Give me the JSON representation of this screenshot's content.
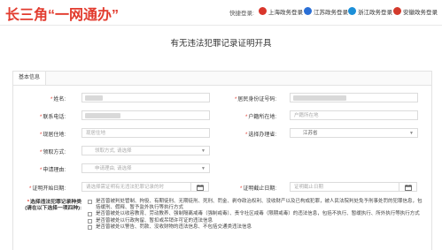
{
  "header": {
    "logo_text": "长三角“一网通办”",
    "quick_login_label": "快捷登录:",
    "province_buttons": [
      {
        "label": "上海政务登录",
        "color": "#d9362b"
      },
      {
        "label": "江苏政务登录",
        "color": "#2a6fd6"
      },
      {
        "label": "浙江政务登录",
        "color": "#1b8fd8"
      },
      {
        "label": "安徽政务登录",
        "color": "#d33a2c"
      }
    ]
  },
  "page_title": "有无违法犯罪记录证明开具",
  "tab": {
    "label": "基本信息"
  },
  "form": {
    "name_label": "姓名:",
    "id_label": "居民身份证号码:",
    "phone_label": "联系电话:",
    "hukou_label": "户籍所在地:",
    "hukou_placeholder": "户籍所在地",
    "residence_label": "现居住地:",
    "residence_placeholder": "现居住地",
    "city_label": "选择办理省:",
    "city_value": "江苏省",
    "pickup_label": "领取方式:",
    "pickup_placeholder": "领取方式, 请选择",
    "reason_label": "申请理由:",
    "reason_placeholder": "申请理由, 请选择",
    "start_label": "证明开始日期:",
    "start_placeholder": "请选择需证明有无违法犯罪记录的时",
    "end_label": "证明截止日期:",
    "end_placeholder": "证明截止日期",
    "record_type_label_line1": "选择违法犯罪记录种类",
    "record_type_label_line2": "(请在以下选择一项四种):",
    "record_options": [
      "是否曾被判处管制、拘役、有期徒刑、无期徒刑、死刑、罚金、剥夺政治权利、没收财产以及已构成犯罪，被人民法院判处免予刑事处罚的犯罪信息，包括缓刑、假释、暂予监外执行等执行方式",
      "是否曾被处以收容教育、劳动教养、强制隔离戒毒（强制戒毒）、责令社区戒毒（限期戒毒）的违法信息，包括不执行、暂缓执行、所外执行等执行方式",
      "是否曾被处以行政拘留、暂扣或吊销许可证的违法信息",
      "是否曾被处以警告、罚款、没收财物的违法信息、不包括交通类违法信息"
    ]
  }
}
